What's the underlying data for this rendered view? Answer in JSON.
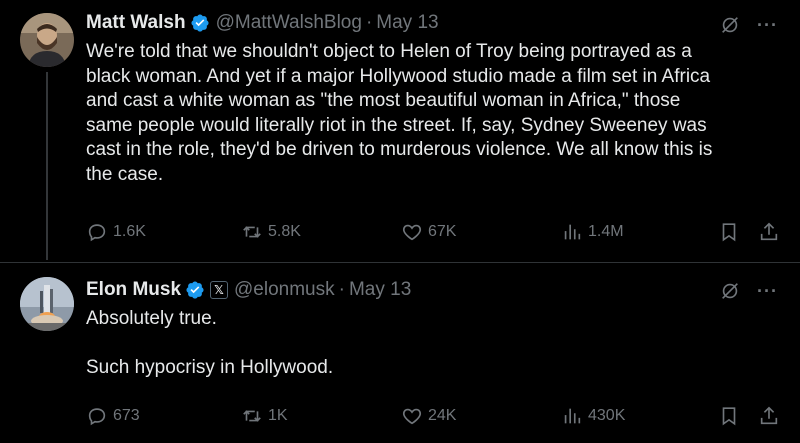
{
  "tweets": [
    {
      "author": "Matt Walsh",
      "handle": "@MattWalshBlog",
      "separator": "·",
      "date": "May 13",
      "more": "···",
      "text_lines": [
        "We're told that we shouldn't object to Helen of Troy being portrayed as a",
        "black woman. And yet if a major Hollywood studio made a film set in Africa",
        "and cast a white woman as \"the most beautiful woman in Africa,\" those",
        "same people would literally riot in the street. If, say, Sydney Sweeney was",
        "cast in the role, they'd be driven to murderous violence. We all know this is",
        "the case."
      ],
      "replies": "1.6K",
      "retweets": "5.8K",
      "likes": "67K",
      "views": "1.4M"
    },
    {
      "author": "Elon Musk",
      "affiliate_badge": "𝕏",
      "handle": "@elonmusk",
      "separator": "·",
      "date": "May 13",
      "more": "···",
      "text_line1": "Absolutely true.",
      "text_line2": "Such hypocrisy in Hollywood.",
      "replies": "673",
      "retweets": "1K",
      "likes": "24K",
      "views": "430K"
    }
  ],
  "icons": {
    "verified": "verified-badge-icon",
    "grok": "grok-icon",
    "reply": "reply-icon",
    "retweet": "retweet-icon",
    "like": "heart-icon",
    "views": "views-icon",
    "bookmark": "bookmark-icon",
    "share": "share-icon"
  },
  "colors": {
    "background": "#000000",
    "text": "#e7e9ea",
    "secondary": "#71767b",
    "verified": "#1d9bf0",
    "border": "#2f3336"
  }
}
